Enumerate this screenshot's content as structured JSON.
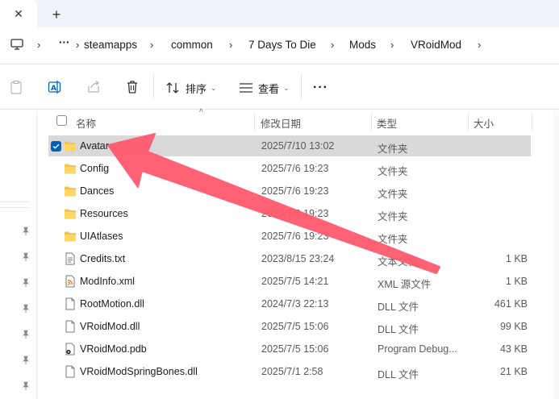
{
  "tabs": {
    "close_glyph": "✕",
    "new_tab_glyph": "+"
  },
  "address": {
    "overflow": "···",
    "separator": "›",
    "crumbs": [
      "steamapps",
      "common",
      "7 Days To Die",
      "Mods",
      "VRoidMod"
    ]
  },
  "toolbar": {
    "sort_label": "排序",
    "view_label": "查看",
    "more_glyph": "···",
    "icons": [
      "paste-icon",
      "rename-icon",
      "share-icon",
      "delete-icon",
      "sort-icon",
      "view-icon"
    ]
  },
  "columns": {
    "name": "名称",
    "date": "修改日期",
    "type": "类型",
    "size": "大小",
    "sort_caret": "^"
  },
  "files": [
    {
      "name": "Avatar",
      "date": "2025/7/10 13:02",
      "type": "文件夹",
      "size": "",
      "icon": "folder-icon",
      "selected": true
    },
    {
      "name": "Config",
      "date": "2025/7/6 19:23",
      "type": "文件夹",
      "size": "",
      "icon": "folder-icon",
      "selected": false
    },
    {
      "name": "Dances",
      "date": "2025/7/6 19:23",
      "type": "文件夹",
      "size": "",
      "icon": "folder-icon",
      "selected": false
    },
    {
      "name": "Resources",
      "date": "2025/7/6 19:23",
      "type": "文件夹",
      "size": "",
      "icon": "folder-icon",
      "selected": false
    },
    {
      "name": "UIAtlases",
      "date": "2025/7/6 19:23",
      "type": "文件夹",
      "size": "",
      "icon": "folder-icon",
      "selected": false
    },
    {
      "name": "Credits.txt",
      "date": "2023/8/15 23:24",
      "type": "文本文档",
      "size": "1 KB",
      "icon": "text-file-icon",
      "selected": false
    },
    {
      "name": "ModInfo.xml",
      "date": "2025/7/5 14:21",
      "type": "XML 源文件",
      "size": "1 KB",
      "icon": "xml-file-icon",
      "selected": false
    },
    {
      "name": "RootMotion.dll",
      "date": "2024/7/3 22:13",
      "type": "DLL 文件",
      "size": "461 KB",
      "icon": "dll-file-icon",
      "selected": false
    },
    {
      "name": "VRoidMod.dll",
      "date": "2025/7/5 15:06",
      "type": "DLL 文件",
      "size": "99 KB",
      "icon": "dll-file-icon",
      "selected": false
    },
    {
      "name": "VRoidMod.pdb",
      "date": "2025/7/5 15:06",
      "type": "Program Debug...",
      "size": "43 KB",
      "icon": "pdb-file-icon",
      "selected": false
    },
    {
      "name": "VRoidModSpringBones.dll",
      "date": "2025/7/1 2:58",
      "type": "DLL 文件",
      "size": "21 KB",
      "icon": "dll-file-icon",
      "selected": false
    }
  ],
  "colors": {
    "accent": "#005fb8",
    "folder": "#f4c44e",
    "selected_row": "#d9d9d9",
    "annotation_arrow": "#ff5a6e"
  }
}
